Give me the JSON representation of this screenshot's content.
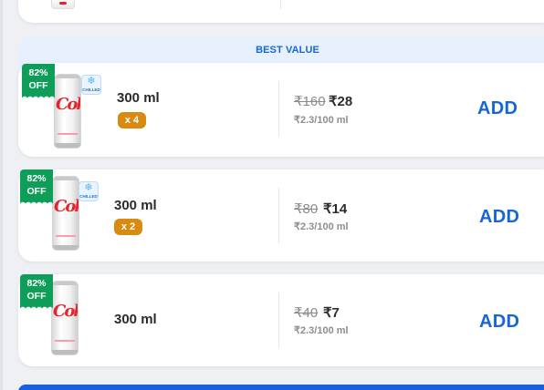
{
  "colors": {
    "accent": "#1766d8",
    "offer_green": "#0f9e5a",
    "pack_badge": "#d98a11",
    "best_value_bg": "#e7f1fd",
    "page_bg": "#eef0f4"
  },
  "best_value": {
    "label": "BEST VALUE"
  },
  "products": [
    {
      "discount_line1": "82%",
      "discount_line2": "OFF",
      "brand_text": "Coke",
      "chilled_label": "CHILLED",
      "quantity": "300 ml",
      "pack": "x 4",
      "mrp": "₹160",
      "price": "₹28",
      "unit_price": "₹2.3/100 ml",
      "add_label": "ADD",
      "icons": [
        "product-can-image",
        "chilled-icon"
      ]
    },
    {
      "discount_line1": "82%",
      "discount_line2": "OFF",
      "brand_text": "Coke",
      "chilled_label": "CHILLED",
      "quantity": "300 ml",
      "pack": "x 2",
      "mrp": "₹80",
      "price": "₹14",
      "unit_price": "₹2.3/100 ml",
      "add_label": "ADD",
      "icons": [
        "product-can-image",
        "chilled-icon"
      ]
    },
    {
      "discount_line1": "82%",
      "discount_line2": "OFF",
      "brand_text": "Coke",
      "quantity": "300 ml",
      "mrp": "₹40",
      "price": "₹7",
      "unit_price": "₹2.3/100 ml",
      "add_label": "ADD",
      "icons": [
        "product-can-image"
      ]
    }
  ]
}
